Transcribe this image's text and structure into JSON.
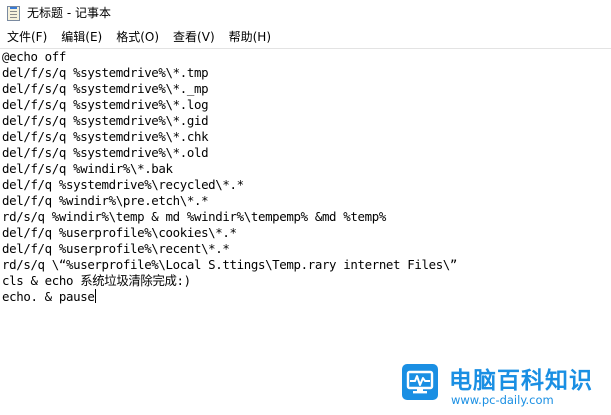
{
  "window": {
    "title": "无标题 - 记事本"
  },
  "menu": [
    {
      "label": "文件(F)"
    },
    {
      "label": "编辑(E)"
    },
    {
      "label": "格式(O)"
    },
    {
      "label": "查看(V)"
    },
    {
      "label": "帮助(H)"
    }
  ],
  "editor": {
    "lines": [
      "@echo off",
      "del/f/s/q %systemdrive%\\*.tmp",
      "del/f/s/q %systemdrive%\\*._mp",
      "del/f/s/q %systemdrive%\\*.log",
      "del/f/s/q %systemdrive%\\*.gid",
      "del/f/s/q %systemdrive%\\*.chk",
      "del/f/s/q %systemdrive%\\*.old",
      "del/f/s/q %windir%\\*.bak",
      "del/f/q %systemdrive%\\recycled\\*.*",
      "del/f/q %windir%\\pre.etch\\*.*",
      "rd/s/q %windir%\\temp & md %windir%\\tempemp% &md %temp%",
      "del/f/q %userprofile%\\cookies\\*.*",
      "del/f/q %userprofile%\\recent\\*.*",
      "rd/s/q \\“%userprofile%\\Local S.ttings\\Temp.rary internet Files\\”",
      "cls & echo 系统垃圾清除完成:)",
      "echo. & pause"
    ]
  },
  "watermark": {
    "title": "电脑百科知识",
    "url": "www.pc-daily.com",
    "color": "#1a8fe3"
  }
}
